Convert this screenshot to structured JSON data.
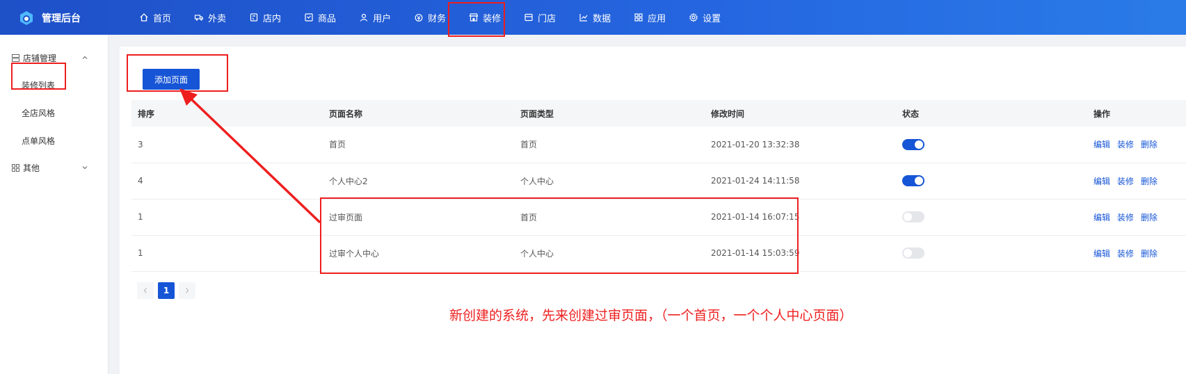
{
  "brand": {
    "title": "管理后台"
  },
  "nav": [
    {
      "label": "首页",
      "icon": "home-icon"
    },
    {
      "label": "外卖",
      "icon": "delivery-icon"
    },
    {
      "label": "店内",
      "icon": "dine-in-icon"
    },
    {
      "label": "商品",
      "icon": "goods-icon"
    },
    {
      "label": "用户",
      "icon": "user-icon"
    },
    {
      "label": "财务",
      "icon": "finance-icon"
    },
    {
      "label": "装修",
      "icon": "store-decor-icon",
      "active": true
    },
    {
      "label": "门店",
      "icon": "shop-icon"
    },
    {
      "label": "数据",
      "icon": "chart-icon"
    },
    {
      "label": "应用",
      "icon": "apps-icon"
    },
    {
      "label": "设置",
      "icon": "gear-icon"
    }
  ],
  "sidebar": {
    "group1": {
      "label": "店铺管理",
      "icon": "store-icon"
    },
    "items": [
      {
        "label": "装修列表"
      },
      {
        "label": "全店风格"
      },
      {
        "label": "点单风格"
      }
    ],
    "group2": {
      "label": "其他",
      "icon": "grid-icon"
    }
  },
  "toolbar": {
    "add_label": "添加页面"
  },
  "table": {
    "headers": [
      "排序",
      "页面名称",
      "页面类型",
      "修改时间",
      "状态",
      "操作"
    ],
    "rows": [
      {
        "order": "3",
        "name": "首页",
        "type": "首页",
        "time": "2021-01-20 13:32:38",
        "status": true
      },
      {
        "order": "4",
        "name": "个人中心2",
        "type": "个人中心",
        "time": "2021-01-24 14:11:58",
        "status": true
      },
      {
        "order": "1",
        "name": "过审页面",
        "type": "首页",
        "time": "2021-01-14 16:07:15",
        "status": false
      },
      {
        "order": "1",
        "name": "过审个人中心",
        "type": "个人中心",
        "time": "2021-01-14 15:03:59",
        "status": false
      }
    ],
    "ops": {
      "edit": "编辑",
      "decorate": "装修",
      "delete": "删除"
    }
  },
  "pagination": {
    "current": "1"
  },
  "annotation": {
    "text": "新创建的系统，先来创建过审页面，（一个首页，一个个人中心页面）"
  },
  "colors": {
    "primary": "#1655d6",
    "annotation": "#ee1e1e"
  }
}
